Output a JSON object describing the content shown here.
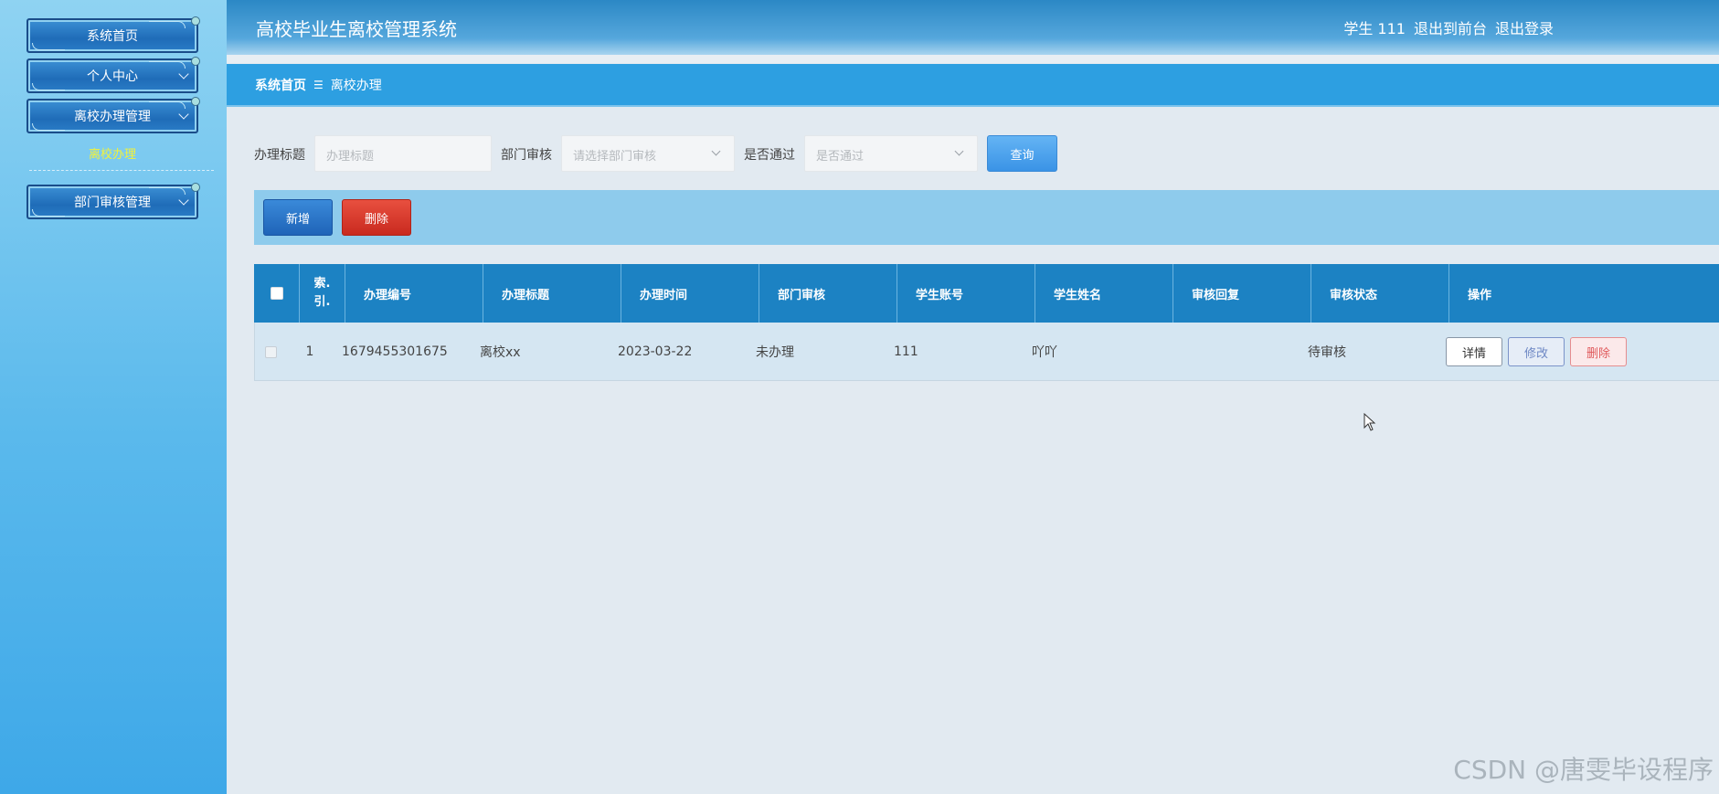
{
  "app": {
    "title": "高校毕业生离校管理系统",
    "user_label": "学生 111",
    "front_link": "退出到前台",
    "logout_link": "退出登录"
  },
  "sidebar": {
    "menus": [
      {
        "label": "系统首页"
      },
      {
        "label": "个人中心"
      },
      {
        "label": "离校办理管理"
      },
      {
        "label": "部门审核管理"
      }
    ],
    "active_submenu": "离校办理"
  },
  "breadcrumb": {
    "home": "系统首页",
    "separator": "☰",
    "current": "离校办理"
  },
  "search": {
    "title_label": "办理标题",
    "title_placeholder": "办理标题",
    "dept_label": "部门审核",
    "dept_placeholder": "请选择部门审核",
    "pass_label": "是否通过",
    "pass_placeholder": "是否通过",
    "query_button": "查询"
  },
  "actions": {
    "add_button": "新增",
    "delete_button": "删除"
  },
  "table": {
    "headers": [
      "索引",
      "办理编号",
      "办理标题",
      "办理时间",
      "部门审核",
      "学生账号",
      "学生姓名",
      "审核回复",
      "审核状态",
      "操作"
    ],
    "index_header_line1": "索.",
    "index_header_line2": "引.",
    "rows": [
      {
        "index": "1",
        "number": "1679455301675",
        "title": "离校xx",
        "time": "2023-03-22",
        "dept_review": "未办理",
        "student_account": "111",
        "student_name": "吖吖",
        "review_reply": "",
        "review_status": "待审核"
      }
    ],
    "row_actions": {
      "detail": "详情",
      "edit": "修改",
      "delete": "删除"
    }
  },
  "watermark": "CSDN @唐雯毕设程序",
  "colors": {
    "header_blue": "#2b88c5",
    "table_header": "#1c82c3",
    "accent_yellow": "#f2f23a",
    "delete_red": "#c92a1f"
  }
}
